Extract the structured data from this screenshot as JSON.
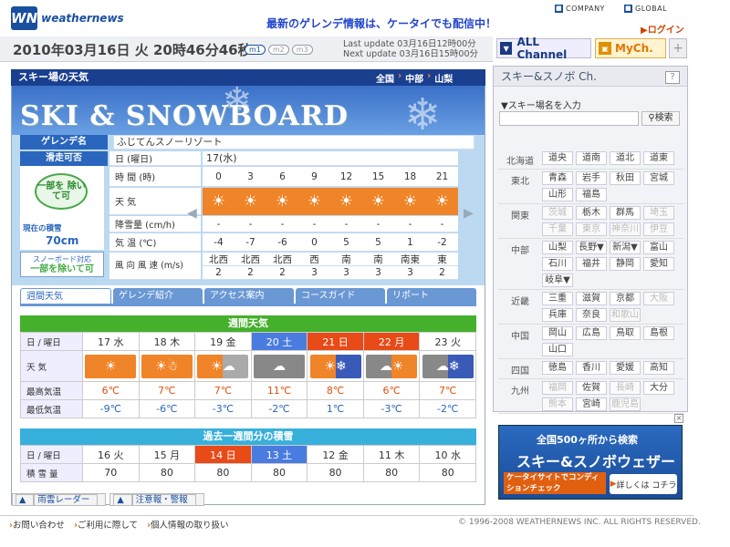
{
  "header": {
    "logo_mark": "WN",
    "logo_text": "weathernews",
    "promo": "最新のゲレンデ情報は、ケータイでも配信中！",
    "links": {
      "company": "COMPANY",
      "global": "GLOBAL"
    },
    "login": "ログイン"
  },
  "datebar": {
    "date": "2010年03月16日 火 20時46分46秒",
    "modes": [
      "m1",
      "m2",
      "m3"
    ],
    "last_update": "Last update  03月16日12時00分",
    "next_update": "Next update  03月16日15時00分"
  },
  "channels": {
    "all": "ALL Channel",
    "my": "MyCh.",
    "plus": "+"
  },
  "panel": {
    "title": "スキー場の天気",
    "breadcrumb": [
      "全国",
      "中部",
      "山梨"
    ],
    "banner_text": "SKI & SNOWBOARD"
  },
  "resort": {
    "name_label": "ゲレンデ名",
    "name": "ふじてんスノーリゾート",
    "status_label": "滑走可否",
    "status": "一部を 除いて可",
    "snow_label": "現在の積雪",
    "snow_value": "70cm",
    "sb_label": "スノーボード対応",
    "sb_value": "一部を除いて可"
  },
  "hourly": {
    "labels": {
      "day": "日 (曜日)",
      "time": "時 間 (時)",
      "weather": "天 気",
      "precip": "降雪量 (cm/h)",
      "temp": "気 温 (℃)",
      "wind": "風 向 風 速 (m/s)"
    },
    "day": "17(水)",
    "hours": [
      "0",
      "3",
      "6",
      "9",
      "12",
      "15",
      "18",
      "21"
    ],
    "precip": [
      "-",
      "-",
      "-",
      "-",
      "-",
      "-",
      "-",
      "-"
    ],
    "temp": [
      "-4",
      "-7",
      "-6",
      "0",
      "5",
      "5",
      "1",
      "-2"
    ],
    "wind_dir": [
      "北西",
      "北西",
      "北西",
      "西",
      "南",
      "南",
      "南東",
      "東"
    ],
    "wind_speed": [
      "2",
      "2",
      "2",
      "3",
      "3",
      "3",
      "3",
      "2"
    ]
  },
  "tabs": [
    "週間天気",
    "ゲレンデ紹介",
    "アクセス案内",
    "コースガイド",
    "リポート"
  ],
  "weekly": {
    "title": "週間天気",
    "row_labels": {
      "day": "日 / 曜日",
      "weather": "天 気",
      "high": "最高気温",
      "low": "最低気温"
    },
    "days": [
      "17 水",
      "18 木",
      "19 金",
      "20 土",
      "21 日",
      "22 月",
      "23 火"
    ],
    "icons": [
      "sun",
      "sun-snow",
      "sun-cloud",
      "cloud",
      "sun-snow",
      "cloud-sun",
      "cloud-snow"
    ],
    "high": [
      "6℃",
      "7℃",
      "7℃",
      "11℃",
      "8℃",
      "6℃",
      "7℃"
    ],
    "low": [
      "-9℃",
      "-6℃",
      "-3℃",
      "-2℃",
      "1℃",
      "-3℃",
      "-2℃"
    ]
  },
  "past": {
    "title": "過去一週間分の積雪",
    "row_labels": {
      "day": "日 / 曜日",
      "snow": "積 雪 量"
    },
    "days": [
      "16 火",
      "15 月",
      "14 日",
      "13 土",
      "12 金",
      "11 木",
      "10 水"
    ],
    "snow": [
      "70",
      "80",
      "80",
      "80",
      "80",
      "80",
      "80"
    ]
  },
  "bottom_links": [
    "雨雲レーダー",
    "注意報・警報"
  ],
  "sidebar": {
    "title": "スキー&スノボ Ch.",
    "help": "?",
    "search_label": "▼スキー場名を入力",
    "search_button": "検索",
    "regions": [
      {
        "name": "北海道",
        "prefs": [
          {
            "n": "道央"
          },
          {
            "n": "道南"
          },
          {
            "n": "道北"
          },
          {
            "n": "道東"
          }
        ]
      },
      {
        "name": "東北",
        "prefs": [
          {
            "n": "青森"
          },
          {
            "n": "岩手"
          },
          {
            "n": "秋田"
          },
          {
            "n": "宮城"
          },
          {
            "n": "山形"
          },
          {
            "n": "福島"
          }
        ]
      },
      {
        "name": "関東",
        "prefs": [
          {
            "n": "茨城",
            "d": 1
          },
          {
            "n": "栃木"
          },
          {
            "n": "群馬"
          },
          {
            "n": "埼玉",
            "d": 1
          },
          {
            "n": "千葉",
            "d": 1
          },
          {
            "n": "東京",
            "d": 1
          },
          {
            "n": "神奈川",
            "d": 1
          },
          {
            "n": "伊豆",
            "d": 1
          }
        ]
      },
      {
        "name": "中部",
        "prefs": [
          {
            "n": "山梨"
          },
          {
            "n": "長野▼"
          },
          {
            "n": "新潟▼"
          },
          {
            "n": "富山"
          },
          {
            "n": "石川"
          },
          {
            "n": "福井"
          },
          {
            "n": "静岡"
          },
          {
            "n": "愛知"
          },
          {
            "n": "岐阜▼"
          }
        ]
      },
      {
        "name": "近畿",
        "prefs": [
          {
            "n": "三重"
          },
          {
            "n": "滋賀"
          },
          {
            "n": "京都"
          },
          {
            "n": "大阪",
            "d": 1
          },
          {
            "n": "兵庫"
          },
          {
            "n": "奈良"
          },
          {
            "n": "和歌山",
            "d": 1
          }
        ]
      },
      {
        "name": "中国",
        "prefs": [
          {
            "n": "岡山"
          },
          {
            "n": "広島"
          },
          {
            "n": "鳥取"
          },
          {
            "n": "島根"
          },
          {
            "n": "山口"
          }
        ]
      },
      {
        "name": "四国",
        "prefs": [
          {
            "n": "徳島"
          },
          {
            "n": "香川"
          },
          {
            "n": "愛媛"
          },
          {
            "n": "高知"
          }
        ]
      },
      {
        "name": "九州",
        "prefs": [
          {
            "n": "福岡",
            "d": 1
          },
          {
            "n": "佐賀"
          },
          {
            "n": "長崎",
            "d": 1
          },
          {
            "n": "大分"
          },
          {
            "n": "熊本",
            "d": 1
          },
          {
            "n": "宮崎"
          },
          {
            "n": "鹿児島",
            "d": 1
          }
        ]
      }
    ]
  },
  "ad": {
    "line1": "全国500ヶ所から検索",
    "line2": "スキー&スノボウェザー",
    "line3": "ケータイサイトでコンディションチェック",
    "button": "詳しくは コチラ"
  },
  "footer": {
    "links": [
      "お問い合わせ",
      "ご利用に際して",
      "個人情報の取り扱い"
    ],
    "copyright": "© 1996-2008 WEATHERNEWS INC. ALL RIGHTS RESERVED."
  }
}
